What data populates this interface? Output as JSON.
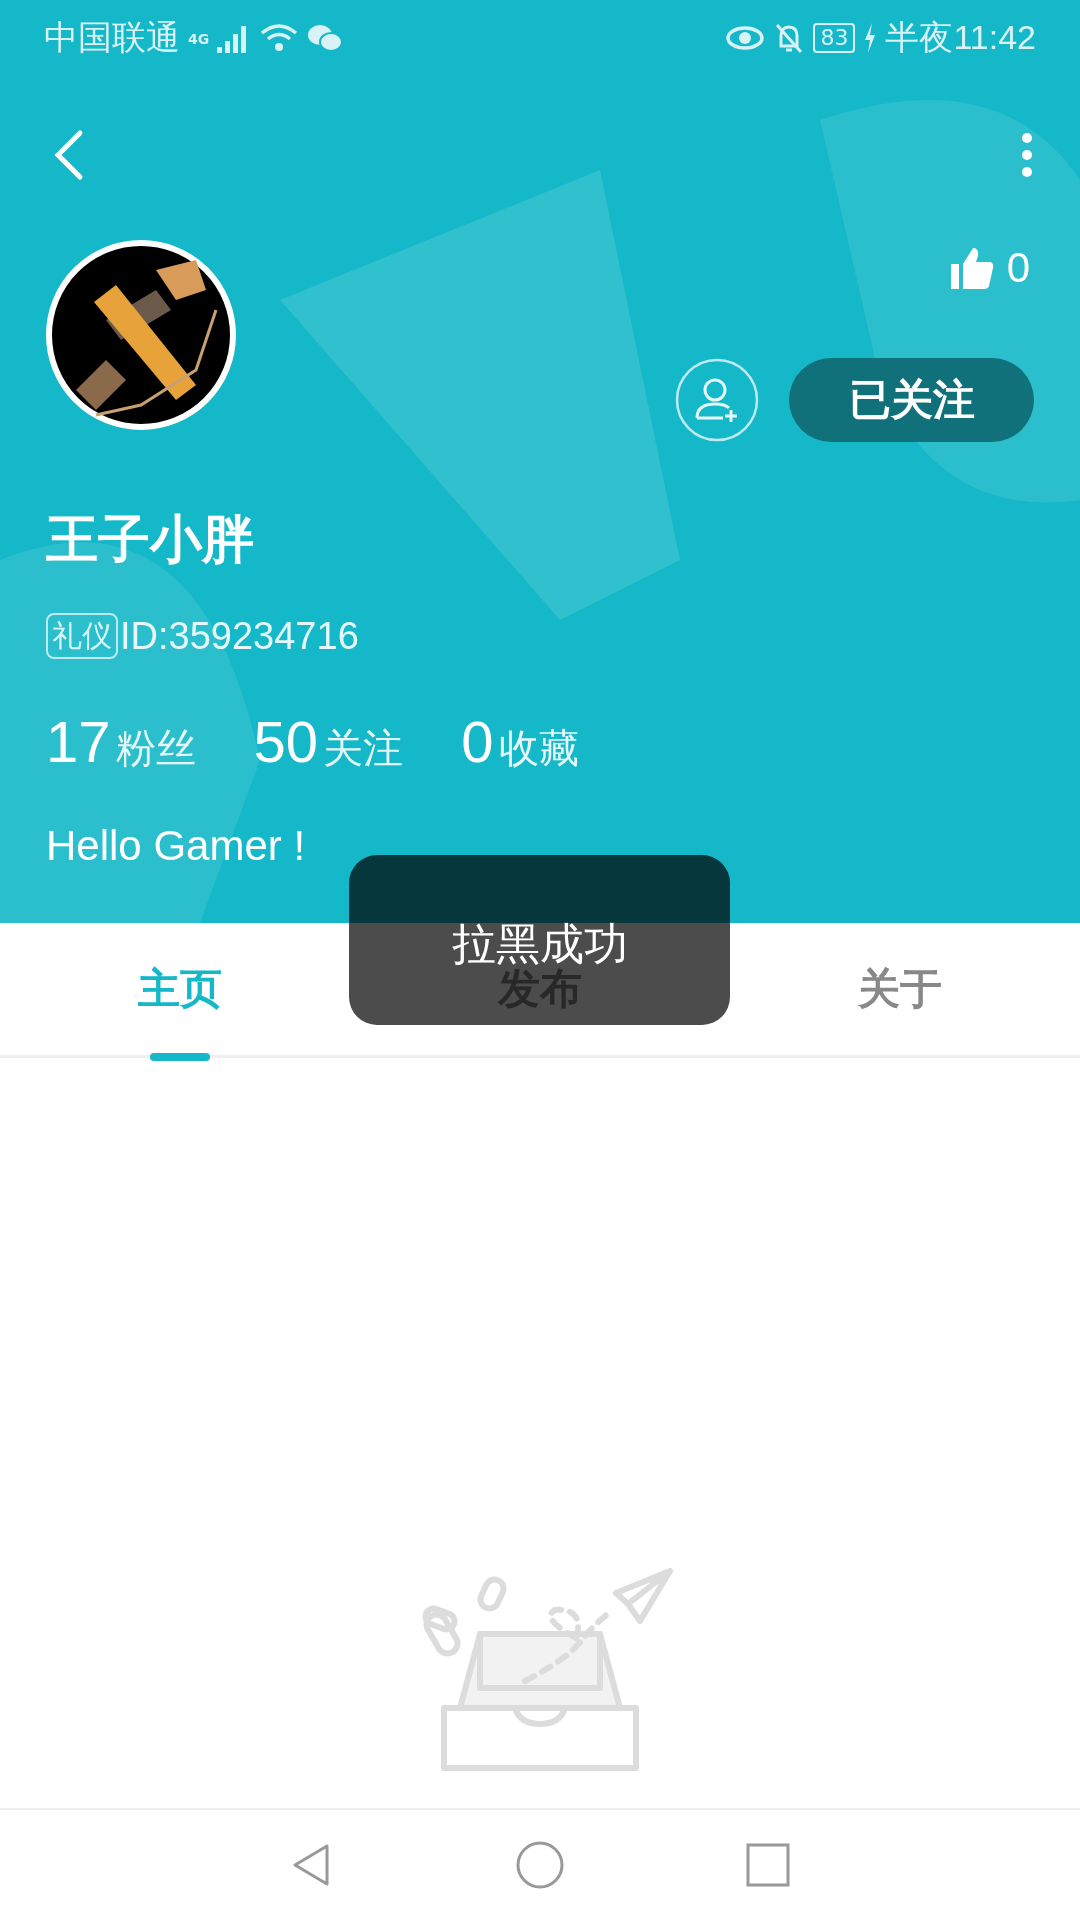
{
  "status_bar": {
    "carrier": "中国联通",
    "network": "4G",
    "battery": "83",
    "time": "半夜11:42"
  },
  "profile": {
    "likes": "0",
    "follow_button": {
      "label": "已关注",
      "followed": true
    },
    "name": "王子小胖",
    "badge": "礼仪",
    "id": "ID:359234716",
    "stats": [
      {
        "count": "17",
        "name": "粉丝"
      },
      {
        "count": "50",
        "name": "关注"
      },
      {
        "count": "0",
        "name": "收藏"
      }
    ],
    "bio": "Hello Gamer !"
  },
  "tabs": [
    {
      "label": "主页",
      "selected": true
    },
    {
      "label": "发布",
      "selected": false
    },
    {
      "label": "关于",
      "selected": false
    }
  ],
  "toast": "拉黑成功"
}
